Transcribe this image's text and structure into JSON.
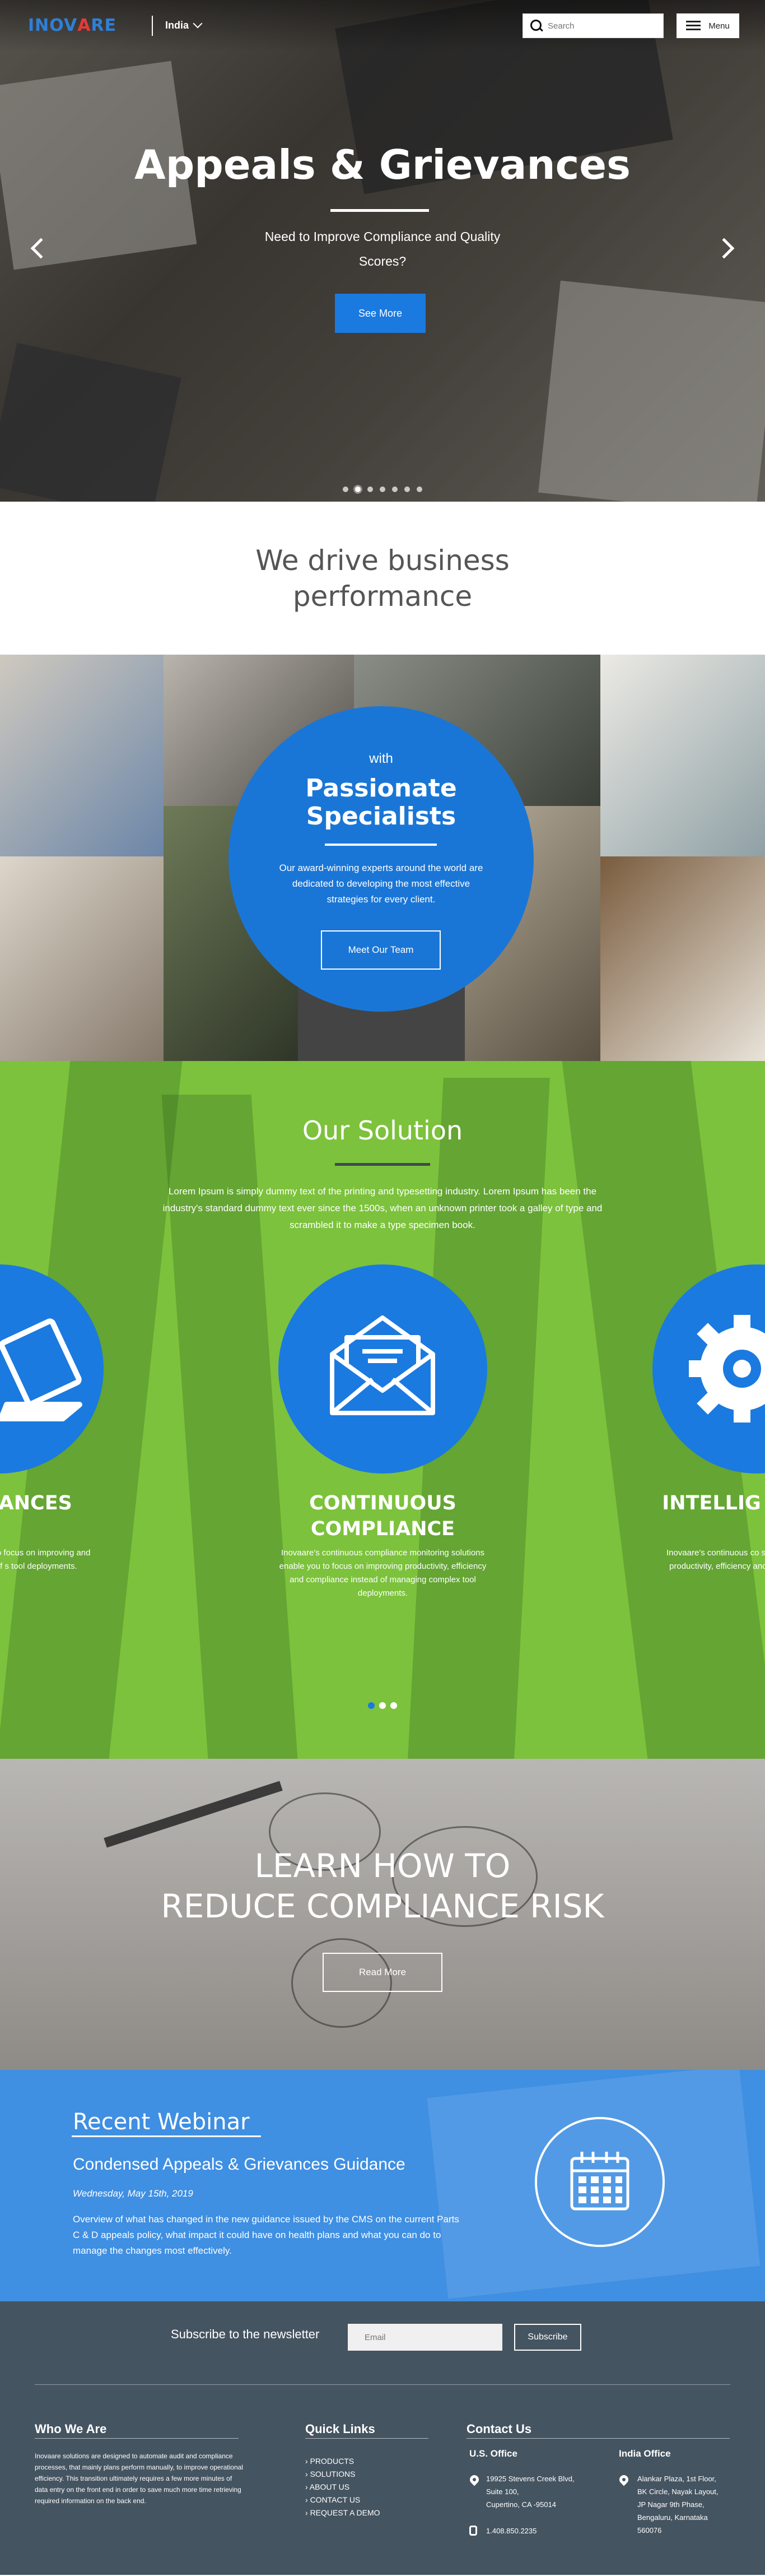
{
  "header": {
    "logo_text": "INOVARE",
    "country": "India",
    "search_placeholder": "Search",
    "menu_label": "Menu"
  },
  "hero": {
    "title": "Appeals & Grievances",
    "subtitle": "Need to Improve Compliance and Quality Scores?",
    "button": "See More",
    "slide_count": 7,
    "active_slide": 2
  },
  "intro": {
    "heading": "We drive business performance"
  },
  "team": {
    "with": "with",
    "title": "Passionate Specialists",
    "text": "Our award-winning experts around the world are dedicated to developing the most effective strategies for every client.",
    "button": "Meet Our Team"
  },
  "solution": {
    "heading": "Our Solution",
    "intro": "Lorem Ipsum is simply dummy text of the printing and typesetting industry. Lorem Ipsum has been the industry's standard dummy text ever since the 1500s, when an unknown printer took a galley of type and scrambled it to make a type specimen book.",
    "cards": [
      {
        "title": "ALS & ANCES",
        "icon": "laptop-icon",
        "text": "compliance monitoring to focus on improving and compliance instead of s tool deployments."
      },
      {
        "title": "CONTINUOUS COMPLIANCE",
        "icon": "envelope-icon",
        "text": "Inovaare's continuous compliance monitoring solutions enable you to focus on improving productivity, efficiency and compliance instead of managing complex tool deployments."
      },
      {
        "title": "INTELLIG PLATFO",
        "icon": "gear-icon",
        "text": "Inovaare's continuous co solutions enable you to productivity, efficiency and managing complex t"
      }
    ],
    "active_dot": 0
  },
  "learn": {
    "heading_line1": "LEARN HOW TO",
    "heading_line2": "REDUCE COMPLIANCE RISK",
    "button": "Read More"
  },
  "webinar": {
    "label": "Recent Webinar",
    "title": "Condensed Appeals & Grievances Guidance",
    "date": "Wednesday, May 15th, 2019",
    "text": "Overview of what has changed in the new guidance issued by the CMS on the current Parts C & D appeals policy, what impact it could have on health plans and what you can do to manage the changes most effectively."
  },
  "footer": {
    "newsletter_label": "Subscribe to the newsletter",
    "email_placeholder": "Email",
    "subscribe_button": "Subscribe",
    "who_heading": "Who We Are",
    "who_text": "Inovaare solutions are designed to automate audit and compliance processes, that mainly plans perform manually, to improve operational efficiency. This transition ultimately requires a few more minutes of data entry on the front end in order to save much more time retrieving required information on the back end.",
    "links_heading": "Quick Links",
    "links": [
      "PRODUCTS",
      "SOLUTIONS",
      "ABOUT US",
      "CONTACT US",
      "REQUEST A DEMO"
    ],
    "contact_heading": "Contact Us",
    "us_office": {
      "heading": "U.S. Office",
      "line1": "19925 Stevens Creek Blvd,",
      "line2": "Suite 100,",
      "line3": "Cupertino, CA -95014",
      "phone": "1.408.850.2235"
    },
    "india_office": {
      "heading": "India Office",
      "line1": "Alankar Plaza, 1st Floor,",
      "line2": "BK Circle, Nayak Layout,",
      "line3": "JP Nagar 9th Phase,",
      "line4": "Bengaluru, Karnataka",
      "line5": "560076"
    }
  },
  "colors": {
    "brand_blue": "#1a7ae0",
    "solution_green": "#7cc23c",
    "footer_bg": "#455461",
    "webinar_blue": "#3f8fe2"
  }
}
